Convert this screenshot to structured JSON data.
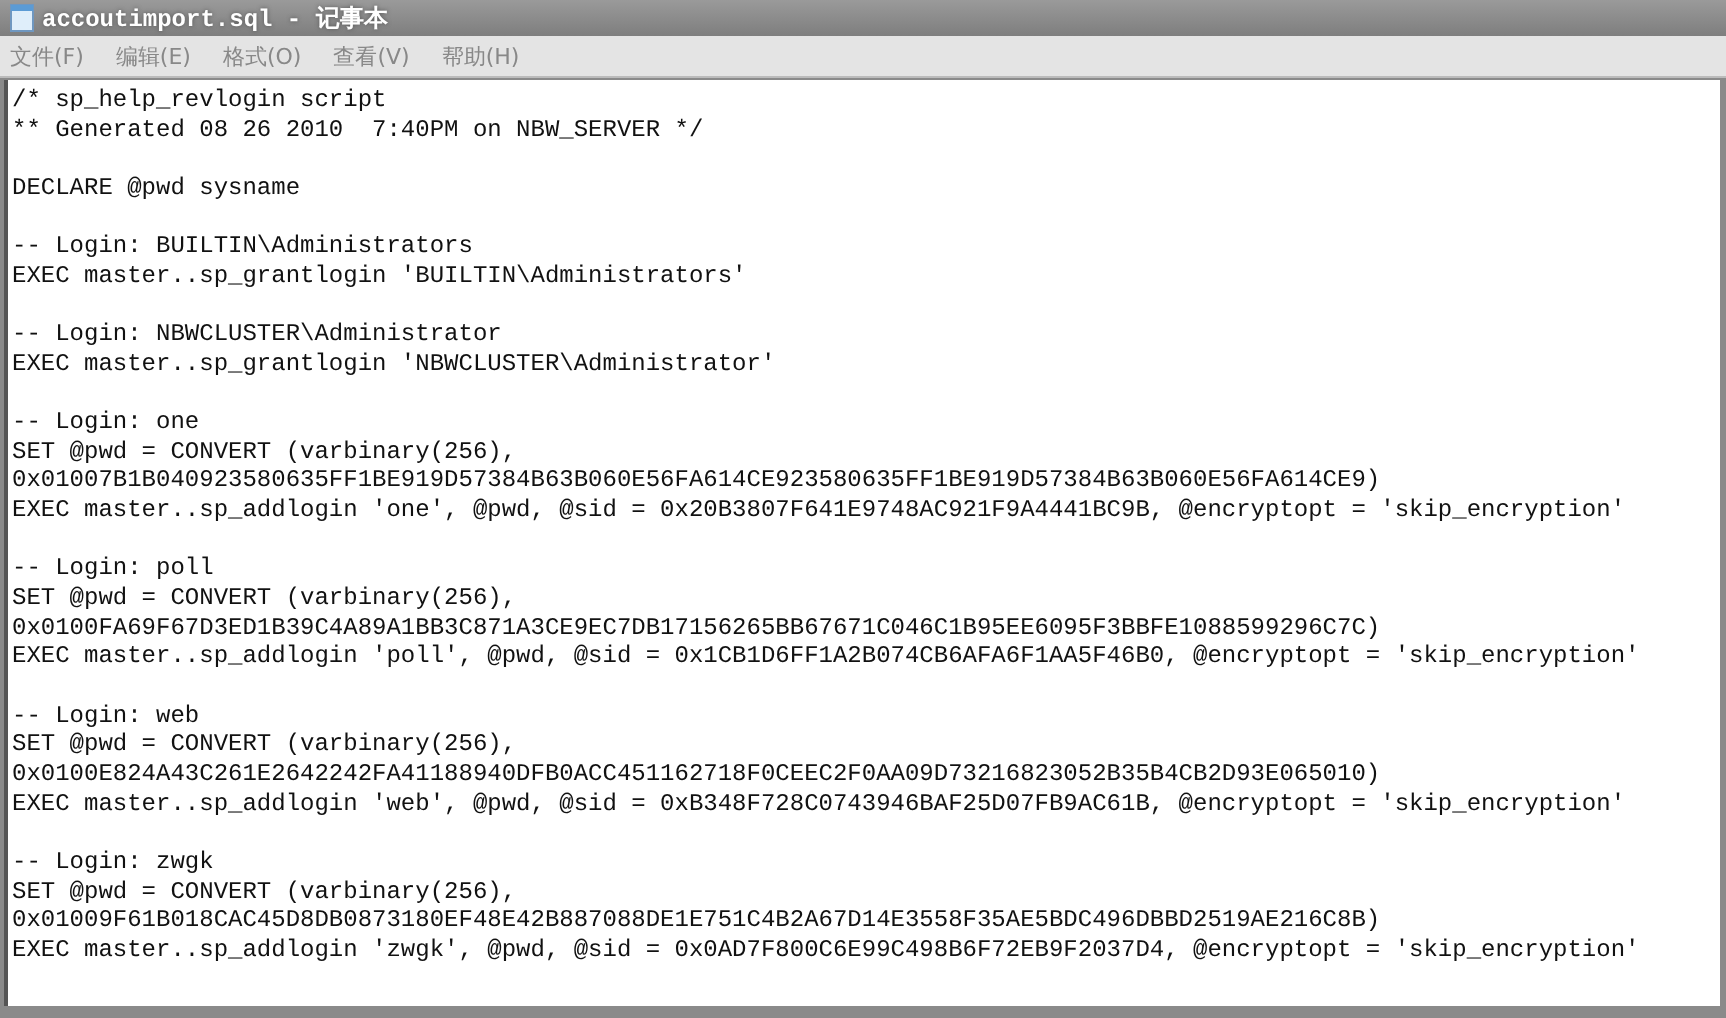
{
  "window": {
    "title": "accoutimport.sql - 记事本"
  },
  "menu": [
    "文件(F)",
    "编辑(E)",
    "格式(O)",
    "查看(V)",
    "帮助(H)"
  ],
  "document": {
    "blocks": [
      [
        "/* sp_help_revlogin script",
        "** Generated 08 26 2010  7:40PM on NBW_SERVER */"
      ],
      [
        "DECLARE @pwd sysname"
      ],
      [
        "-- Login: BUILTIN\\Administrators",
        "EXEC master..sp_grantlogin 'BUILTIN\\Administrators'"
      ],
      [
        "-- Login: NBWCLUSTER\\Administrator",
        "EXEC master..sp_grantlogin 'NBWCLUSTER\\Administrator'"
      ],
      [
        "-- Login: one",
        "SET @pwd = CONVERT (varbinary(256),",
        "0x01007B1B040923580635FF1BE919D57384B63B060E56FA614CE923580635FF1BE919D57384B63B060E56FA614CE9)",
        "EXEC master..sp_addlogin 'one', @pwd, @sid = 0x20B3807F641E9748AC921F9A4441BC9B, @encryptopt = 'skip_encryption'"
      ],
      [
        "-- Login: poll",
        "SET @pwd = CONVERT (varbinary(256),",
        "0x0100FA69F67D3ED1B39C4A89A1BB3C871A3CE9EC7DB17156265BB67671C046C1B95EE6095F3BBFE1088599296C7C)",
        "EXEC master..sp_addlogin 'poll', @pwd, @sid = 0x1CB1D6FF1A2B074CB6AFA6F1AA5F46B0, @encryptopt = 'skip_encryption'"
      ],
      [
        "-- Login: web",
        "SET @pwd = CONVERT (varbinary(256),",
        "0x0100E824A43C261E2642242FA41188940DFB0ACC451162718F0CEEC2F0AA09D73216823052B35B4CB2D93E065010)",
        "EXEC master..sp_addlogin 'web', @pwd, @sid = 0xB348F728C0743946BAF25D07FB9AC61B, @encryptopt = 'skip_encryption'"
      ],
      [
        "-- Login: zwgk",
        "SET @pwd = CONVERT (varbinary(256),",
        "0x01009F61B018CAC45D8DB0873180EF48E42B887088DE1E751C4B2A67D14E3558F35AE5BDC496DBBD2519AE216C8B)",
        "EXEC master..sp_addlogin 'zwgk', @pwd, @sid = 0x0AD7F800C6E99C498B6F72EB9F2037D4, @encryptopt = 'skip_encryption'"
      ]
    ]
  }
}
